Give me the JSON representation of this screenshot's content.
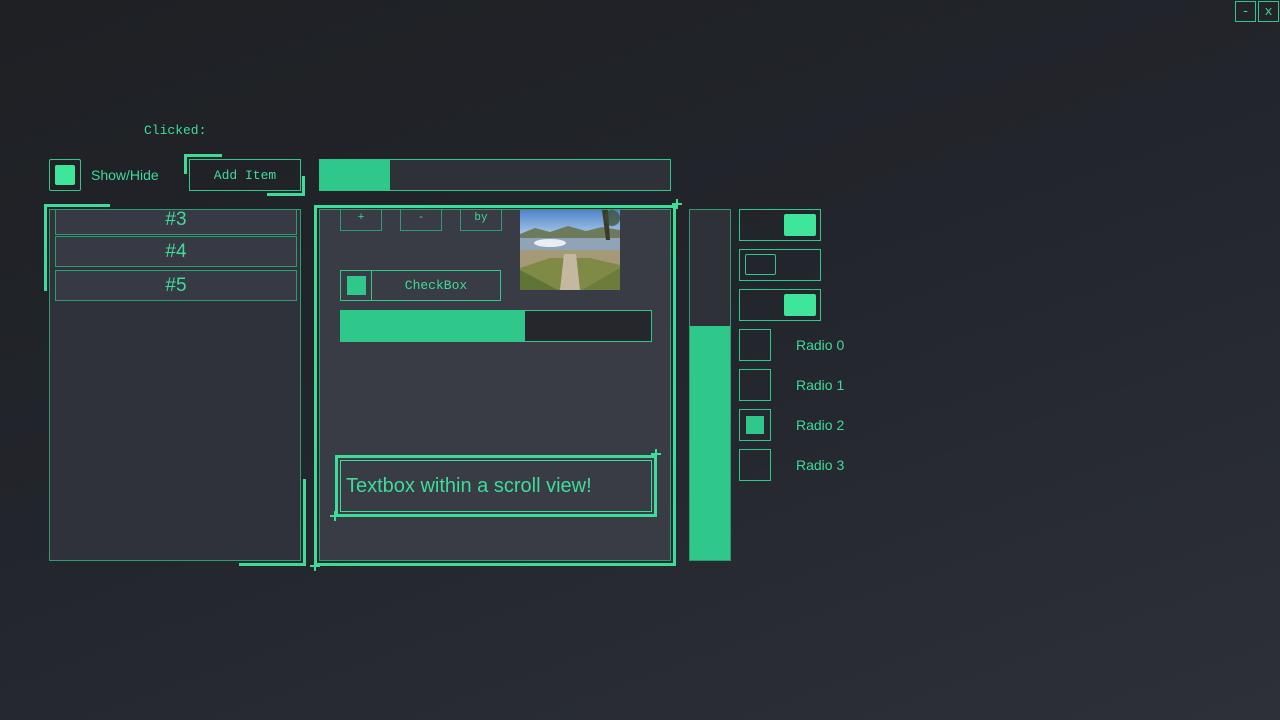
{
  "window": {
    "minimize_label": "-",
    "close_label": "x"
  },
  "status": {
    "clicked_label": "Clicked:"
  },
  "show_hide": {
    "label": "Show/Hide",
    "checked": true
  },
  "add_item_button": {
    "label": "Add Item"
  },
  "top_progress": {
    "value_fraction": 0.2
  },
  "list": {
    "items": [
      {
        "label": "#3"
      },
      {
        "label": "#4"
      },
      {
        "label": "#5"
      }
    ]
  },
  "scroll_view": {
    "mini_buttons": [
      {
        "label": "+"
      },
      {
        "label": "-"
      },
      {
        "label": "by"
      }
    ],
    "checkbox": {
      "label": "CheckBox",
      "checked": true
    },
    "progress": {
      "value_fraction": 0.595
    },
    "textbox": {
      "value": "Textbox within a scroll view!"
    }
  },
  "vertical_slider": {
    "value_fraction": 0.67
  },
  "toggles": [
    {
      "on": true
    },
    {
      "on": false
    },
    {
      "on": true
    }
  ],
  "radios": {
    "selected": "Radio 2",
    "options": [
      {
        "label": "Radio 0",
        "checked": false
      },
      {
        "label": "Radio 1",
        "checked": false
      },
      {
        "label": "Radio 2",
        "checked": true
      },
      {
        "label": "Radio 3",
        "checked": false
      }
    ]
  },
  "colors": {
    "accent": "#3ddc97",
    "accent_dim": "#2fc88a",
    "panel_bg": "#393b45",
    "background": "#22252b"
  }
}
